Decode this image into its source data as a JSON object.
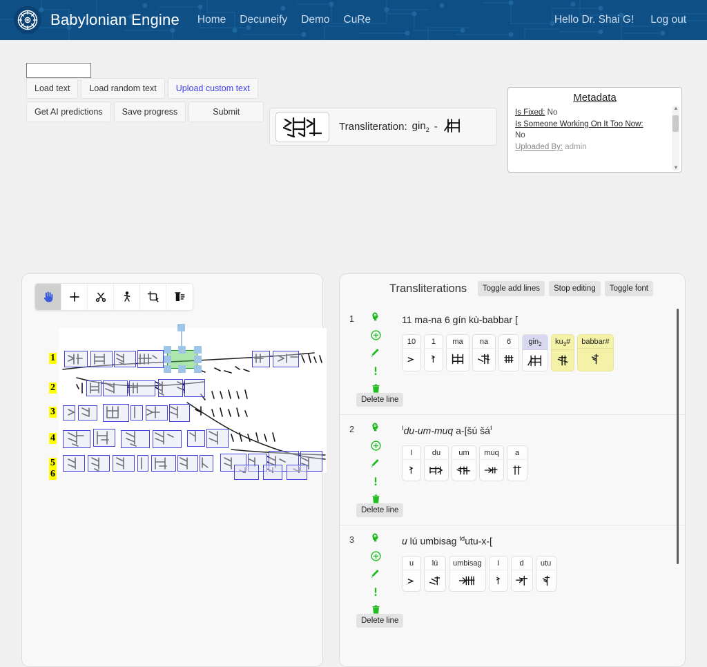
{
  "navbar": {
    "logo_icon": "gear-compass-icon",
    "brand": "Babylonian Engine",
    "links": [
      {
        "label": "Home"
      },
      {
        "label": "Decuneify"
      },
      {
        "label": "Demo"
      },
      {
        "label": "CuRe"
      }
    ],
    "greeting": "Hello Dr. Shai G!",
    "logout": "Log out"
  },
  "controls": {
    "load_input_value": "",
    "load_input_placeholder": "",
    "buttons": [
      {
        "label": "Load text",
        "style": "default"
      },
      {
        "label": "Load random text",
        "style": "default"
      },
      {
        "label": "Upload custom text",
        "style": "link"
      },
      {
        "label": "Get AI predictions",
        "style": "default"
      },
      {
        "label": "Save progress",
        "style": "default"
      },
      {
        "label": "Submit",
        "style": "default"
      }
    ]
  },
  "translit_strip": {
    "thumbnail_icon": "cuneiform-sign-thumbnail",
    "label": "Transliteration:",
    "value": "gin",
    "value_sub": "2",
    "separator": "-",
    "glyph_icon": "cuneiform-gin2-glyph"
  },
  "metadata": {
    "title": "Metadata",
    "rows": [
      {
        "key": "Is Fixed:",
        "value": "No",
        "inline": true
      },
      {
        "key": "Is Someone Working On It Too Now:",
        "value": "No",
        "inline": false
      },
      {
        "key": "Uploaded By:",
        "value": "admin",
        "inline": true
      }
    ],
    "scroll_up_icon": "scroll-up-arrow",
    "scroll_down_icon": "scroll-down-arrow"
  },
  "image_editor": {
    "tools": [
      {
        "name": "hand-icon",
        "label": "Pan",
        "active": true
      },
      {
        "name": "plus-icon",
        "label": "Add",
        "active": false
      },
      {
        "name": "scissors-icon",
        "label": "Cut",
        "active": false
      },
      {
        "name": "split-person-icon",
        "label": "Split",
        "active": false
      },
      {
        "name": "crop-icon",
        "label": "Crop",
        "active": false
      },
      {
        "name": "trash-list-icon",
        "label": "Delete",
        "active": false
      }
    ],
    "line_numbers": [
      "1",
      "2",
      "3",
      "4",
      "5",
      "6"
    ]
  },
  "right_panel": {
    "title": "Transliterations",
    "buttons": [
      {
        "label": "Toggle add lines"
      },
      {
        "label": "Stop editing"
      },
      {
        "label": "Toggle font"
      }
    ],
    "row_icons": [
      {
        "name": "ai-head-icon"
      },
      {
        "name": "circle-plus-icon"
      },
      {
        "name": "pencil-icon"
      },
      {
        "name": "exclamation-icon"
      },
      {
        "name": "trash-icon"
      }
    ],
    "delete_line_label": "Delete line",
    "rows": [
      {
        "index": "1",
        "text_html": "11 ma-na 6 gín kù-babbar [",
        "cards": [
          {
            "label": "10",
            "label_sub": "",
            "glyph": "num10-glyph",
            "highlight": "none"
          },
          {
            "label": "1",
            "label_sub": "",
            "glyph": "num1-glyph",
            "highlight": "none"
          },
          {
            "label": "ma",
            "label_sub": "",
            "glyph": "ma-glyph",
            "highlight": "none"
          },
          {
            "label": "na",
            "label_sub": "",
            "glyph": "na-glyph",
            "highlight": "none"
          },
          {
            "label": "6",
            "label_sub": "",
            "glyph": "num6-glyph",
            "highlight": "none"
          },
          {
            "label": "gin",
            "label_sub": "2",
            "glyph": "gin2-glyph",
            "highlight": "head"
          },
          {
            "label": "ku",
            "label_sub": "3",
            "label_suffix": "#",
            "glyph": "ku3-glyph",
            "highlight": "full"
          },
          {
            "label": "babbar#",
            "label_sub": "",
            "glyph": "babbar-glyph",
            "highlight": "full"
          }
        ]
      },
      {
        "index": "2",
        "text_html": "<sup>I</sup><i>du-um-muq</i> a-[šú šá<sup>I</sup>",
        "cards": [
          {
            "label": "I",
            "label_sub": "",
            "glyph": "i-glyph",
            "highlight": "none"
          },
          {
            "label": "du",
            "label_sub": "",
            "glyph": "du-glyph",
            "highlight": "none"
          },
          {
            "label": "um",
            "label_sub": "",
            "glyph": "um-glyph",
            "highlight": "none"
          },
          {
            "label": "muq",
            "label_sub": "",
            "glyph": "muq-glyph",
            "highlight": "none"
          },
          {
            "label": "a",
            "label_sub": "",
            "glyph": "a-glyph",
            "highlight": "none"
          }
        ]
      },
      {
        "index": "3",
        "text_html": "<i>u</i> lú umbisag <sup>Id</sup>utu-x-[",
        "cards": [
          {
            "label": "u",
            "label_sub": "",
            "glyph": "u-glyph",
            "highlight": "none"
          },
          {
            "label": "lú",
            "label_sub": "",
            "glyph": "lu-glyph",
            "highlight": "none"
          },
          {
            "label": "umbisag",
            "label_sub": "",
            "glyph": "umbisag-glyph",
            "highlight": "none"
          },
          {
            "label": "I",
            "label_sub": "",
            "glyph": "i2-glyph",
            "highlight": "none"
          },
          {
            "label": "d",
            "label_sub": "",
            "glyph": "d-glyph",
            "highlight": "none"
          },
          {
            "label": "utu",
            "label_sub": "",
            "glyph": "utu-glyph",
            "highlight": "none"
          }
        ]
      }
    ]
  },
  "colors": {
    "nav_bg": "#0e4f86",
    "accent_link": "#3d3df0",
    "panel_bg": "#f8f8f8",
    "page_bg": "#f0f0f0",
    "icon_green": "#22bb22",
    "selection_green": "#11a011",
    "box_blue": "#4444dd",
    "handle_blue": "#9ec4e8",
    "line_number_yellow": "#ffff00",
    "card_highlight_yellow": "#f4f2a6",
    "card_highlight_lavender": "#d8d8f0"
  }
}
